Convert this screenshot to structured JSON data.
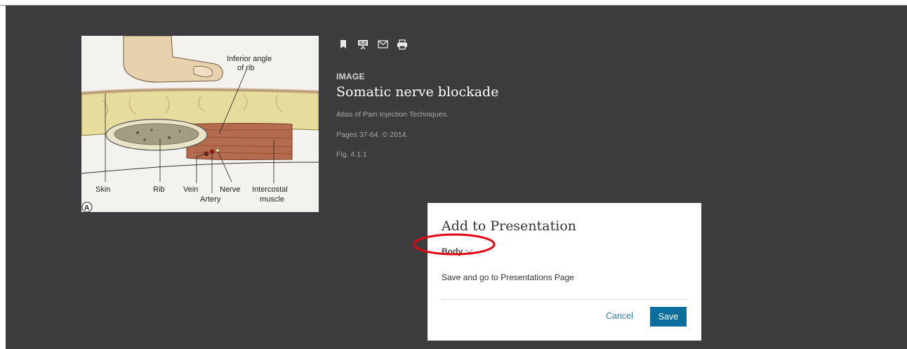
{
  "figure": {
    "labels": {
      "inferior_angle_1": "Inferior angle",
      "inferior_angle_2": "of rib",
      "skin": "Skin",
      "rib": "Rib",
      "vein": "Vein",
      "artery": "Artery",
      "nerve": "Nerve",
      "intercostal_1": "Intercostal",
      "intercostal_2": "muscle",
      "panel_letter": "A"
    }
  },
  "toolbar": {
    "icons": [
      "bookmark-icon",
      "presentation-icon",
      "email-icon",
      "print-icon"
    ]
  },
  "meta": {
    "kind": "IMAGE",
    "title": "Somatic nerve blockade",
    "source": "Atlas of Pain Injection Techniques.",
    "pages": "Pages 37-64. © 2014.",
    "fig": "Fig. 4.1.1"
  },
  "dialog": {
    "title": "Add to Presentation",
    "folder": "Body",
    "link": "Save and go to Presentations Page",
    "cancel": "Cancel",
    "save": "Save"
  },
  "colors": {
    "panel_bg": "#3c3c3e",
    "primary_button": "#0c6e9d",
    "link": "#2f7ba8",
    "annotation": "#e30613"
  }
}
